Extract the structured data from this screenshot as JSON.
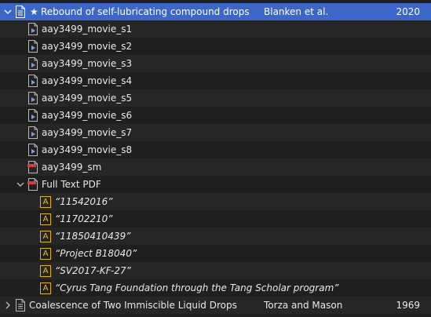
{
  "items": {
    "parent": {
      "star": "★",
      "title": "Rebound of self-lubricating compound drops",
      "authors": "Blanken et al.",
      "year": "2020"
    },
    "files": [
      {
        "name": "aay3499_movie_s1"
      },
      {
        "name": "aay3499_movie_s2"
      },
      {
        "name": "aay3499_movie_s3"
      },
      {
        "name": "aay3499_movie_s4"
      },
      {
        "name": "aay3499_movie_s5"
      },
      {
        "name": "aay3499_movie_s6"
      },
      {
        "name": "aay3499_movie_s7"
      },
      {
        "name": "aay3499_movie_s8"
      },
      {
        "name": "aay3499_sm"
      }
    ],
    "pdf": {
      "name": "Full Text PDF"
    },
    "annotations": [
      {
        "badge": "A",
        "text": "“11542016”"
      },
      {
        "badge": "A",
        "text": "“11702210”"
      },
      {
        "badge": "A",
        "text": "“11850410439”"
      },
      {
        "badge": "A",
        "text": "“Project B18040”"
      },
      {
        "badge": "A",
        "text": "“SV2017-KF-27”"
      },
      {
        "badge": "A",
        "text": "“Cyrus Tang Foundation through the Tang Scholar program”"
      }
    ],
    "next": {
      "title": "Coalescence of Two Immiscible Liquid Drops",
      "authors": "Torza and Mason",
      "year": "1969"
    }
  },
  "colors": {
    "selection": "#3a67c9",
    "highlight": "#e2b400",
    "pdf": "#d93a3a",
    "video": "#7fa0e0"
  }
}
